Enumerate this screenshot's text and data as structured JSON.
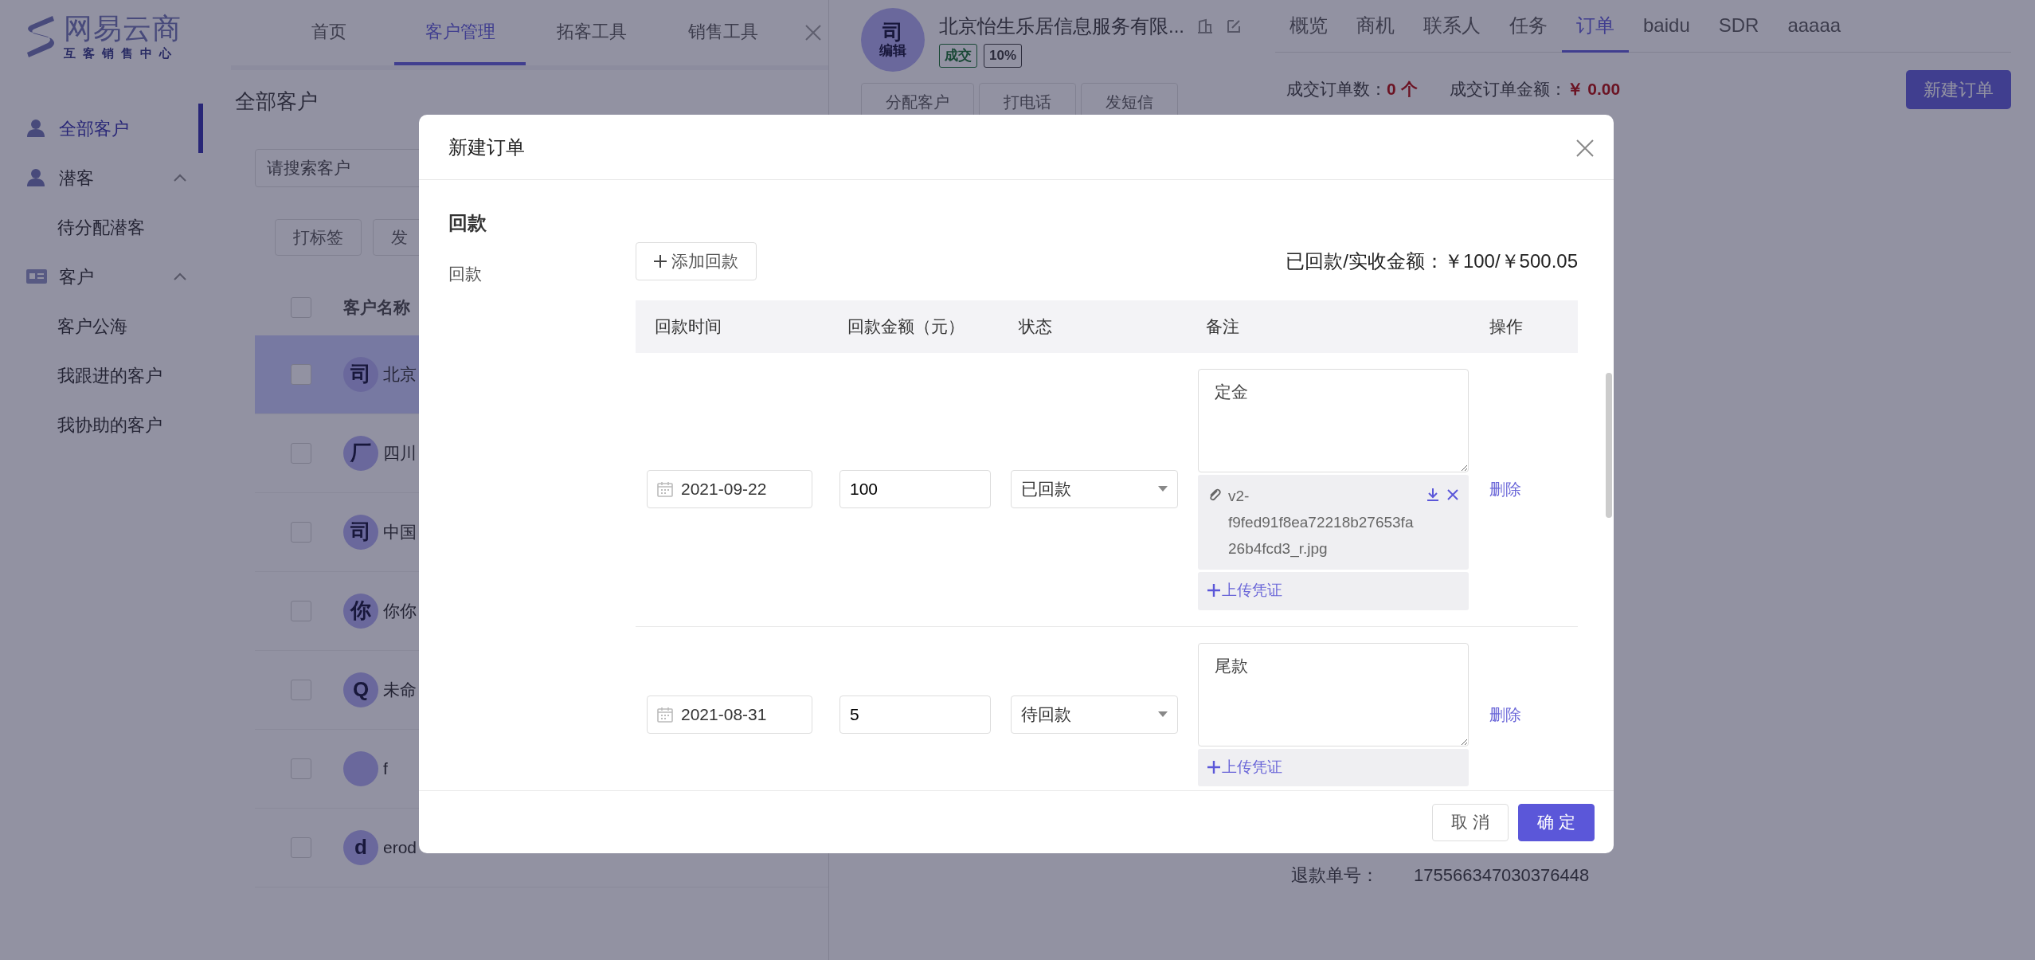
{
  "logo": {
    "title": "网易云商",
    "subtitle": "互客销售中心"
  },
  "top_nav": [
    {
      "label": "首页",
      "selected": false
    },
    {
      "label": "客户管理",
      "selected": true
    },
    {
      "label": "拓客工具",
      "selected": false
    },
    {
      "label": "销售工具",
      "selected": false
    }
  ],
  "sidebar": [
    {
      "label": "全部客户",
      "selected": true
    },
    {
      "label": "潜客",
      "selected": false,
      "expanded": true,
      "children": [
        {
          "label": "待分配潜客",
          "selected": false
        }
      ]
    },
    {
      "label": "客户",
      "selected": false,
      "expanded": true,
      "children": [
        {
          "label": "客户公海",
          "selected": false
        },
        {
          "label": "我跟进的客户",
          "selected": false
        },
        {
          "label": "我协助的客户",
          "selected": false
        }
      ]
    }
  ],
  "customer_list": {
    "title": "全部客户",
    "search_placeholder": "请搜索客户",
    "actions": [
      "打标签",
      "发"
    ],
    "column": "客户名称",
    "header_checked": false,
    "rows": [
      {
        "avatar": "司",
        "name": "北京",
        "selected": true,
        "checked": false
      },
      {
        "avatar": "厂",
        "name": "四川",
        "selected": false,
        "checked": false
      },
      {
        "avatar": "司",
        "name": "中国",
        "selected": false,
        "checked": false
      },
      {
        "avatar": "你",
        "name": "你你",
        "selected": false,
        "checked": false
      },
      {
        "avatar": "Q",
        "name": "未命",
        "selected": false,
        "checked": false
      },
      {
        "name": "f",
        "selected": false,
        "checked": false
      },
      {
        "avatar": "d",
        "name": "erod",
        "selected": false,
        "checked": false
      }
    ]
  },
  "detail": {
    "avatar": "司",
    "avatar_label": "编辑",
    "company": "北京怡生乐居信息服务有限...",
    "tags": [
      "成交",
      "10%"
    ],
    "actions": [
      "分配客户",
      "打电话",
      "发短信"
    ],
    "tabs": [
      {
        "label": "概览",
        "selected": false
      },
      {
        "label": "商机",
        "selected": false
      },
      {
        "label": "联系人",
        "selected": false
      },
      {
        "label": "任务",
        "selected": false
      },
      {
        "label": "订单",
        "selected": true
      },
      {
        "label": "baidu",
        "selected": false
      },
      {
        "label": "SDR",
        "selected": false
      },
      {
        "label": "aaaaa",
        "selected": false
      }
    ],
    "stats": [
      {
        "label": "成交订单数：",
        "value": "0 个"
      },
      {
        "label": "成交订单金额：",
        "value": "￥ 0.00"
      }
    ],
    "new_order_button": "新建订单",
    "refund": {
      "label": "退款单号：",
      "value": "175566347030376448"
    }
  },
  "modal": {
    "title": "新建订单",
    "section": "回款",
    "field_label": "回款",
    "add_button": "添加回款",
    "summary_label": "已回款/实收金额：",
    "summary_value": "￥100/￥500.05",
    "columns": [
      "回款时间",
      "回款金额（元）",
      "状态",
      "备注",
      "操作"
    ],
    "rows": [
      {
        "date": "2021-09-22",
        "amount": "100",
        "status": "已回款",
        "remark": "定金",
        "attachments": [
          {
            "name": "v2-f9fed91f8ea72218b27653fa26b4fcd3_r.jpg"
          }
        ],
        "upload": "上传凭证",
        "action": "删除"
      },
      {
        "date": "2021-08-31",
        "amount": "5",
        "status": "待回款",
        "remark": "尾款",
        "upload": "上传凭证",
        "action": "删除"
      }
    ],
    "buttons": [
      {
        "label": "取 消",
        "kind": "default"
      },
      {
        "label": "确 定",
        "kind": "primary"
      }
    ]
  }
}
